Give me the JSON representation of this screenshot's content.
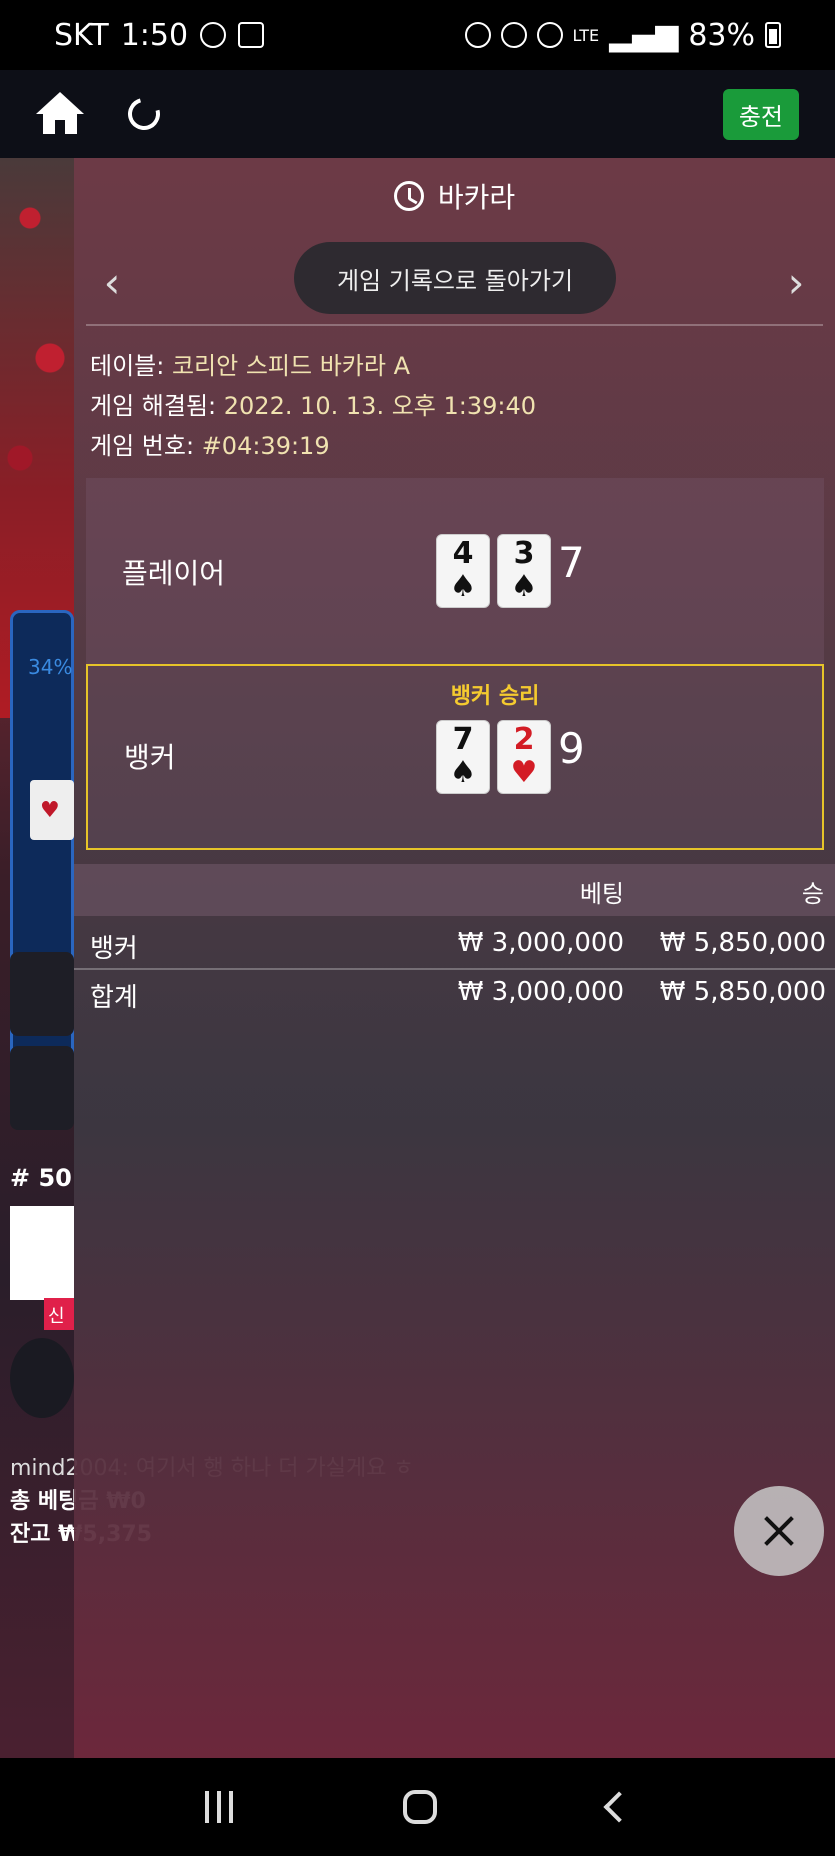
{
  "status_bar": {
    "carrier": "SKT",
    "time": "1:50",
    "battery": "83%",
    "network": "LTE"
  },
  "top_bar": {
    "charge_label": "충전"
  },
  "background": {
    "percent": "34%",
    "round_number": "# 50",
    "new_badge": "신",
    "chat_line": "mind2004: 여기서 행 하나 더 가실게요 ㅎ",
    "total_bet": "총 베팅금 ₩0",
    "balance": "잔고 ₩5,375"
  },
  "panel": {
    "title": "바카라",
    "back_button": "게임 기록으로 돌아가기",
    "info": {
      "table_label": "테이블:",
      "table_value": "코리안 스피드 바카라 A",
      "resolved_label": "게임 해결됨:",
      "resolved_value": "2022. 10. 13. 오후 1:39:40",
      "game_no_label": "게임 번호:",
      "game_no_value": "#04:39:19"
    },
    "player": {
      "label": "플레이어",
      "cards": [
        {
          "rank": "4",
          "suit": "♠",
          "color": "black"
        },
        {
          "rank": "3",
          "suit": "♠",
          "color": "black"
        }
      ],
      "total": "7"
    },
    "banker": {
      "label": "뱅커",
      "win_label": "뱅커 승리",
      "cards": [
        {
          "rank": "7",
          "suit": "♠",
          "color": "black"
        },
        {
          "rank": "2",
          "suit": "♥",
          "color": "red"
        }
      ],
      "total": "9"
    },
    "bets": {
      "header_bet": "베팅",
      "header_win": "승",
      "rows": [
        {
          "label": "뱅커",
          "bet": "₩ 3,000,000",
          "win": "₩ 5,850,000"
        },
        {
          "label": "합계",
          "bet": "₩ 3,000,000",
          "win": "₩ 5,850,000"
        }
      ]
    }
  },
  "colors": {
    "accent_win": "#e6c429",
    "charge_green": "#1a9b3a",
    "card_red": "#d31c25"
  }
}
